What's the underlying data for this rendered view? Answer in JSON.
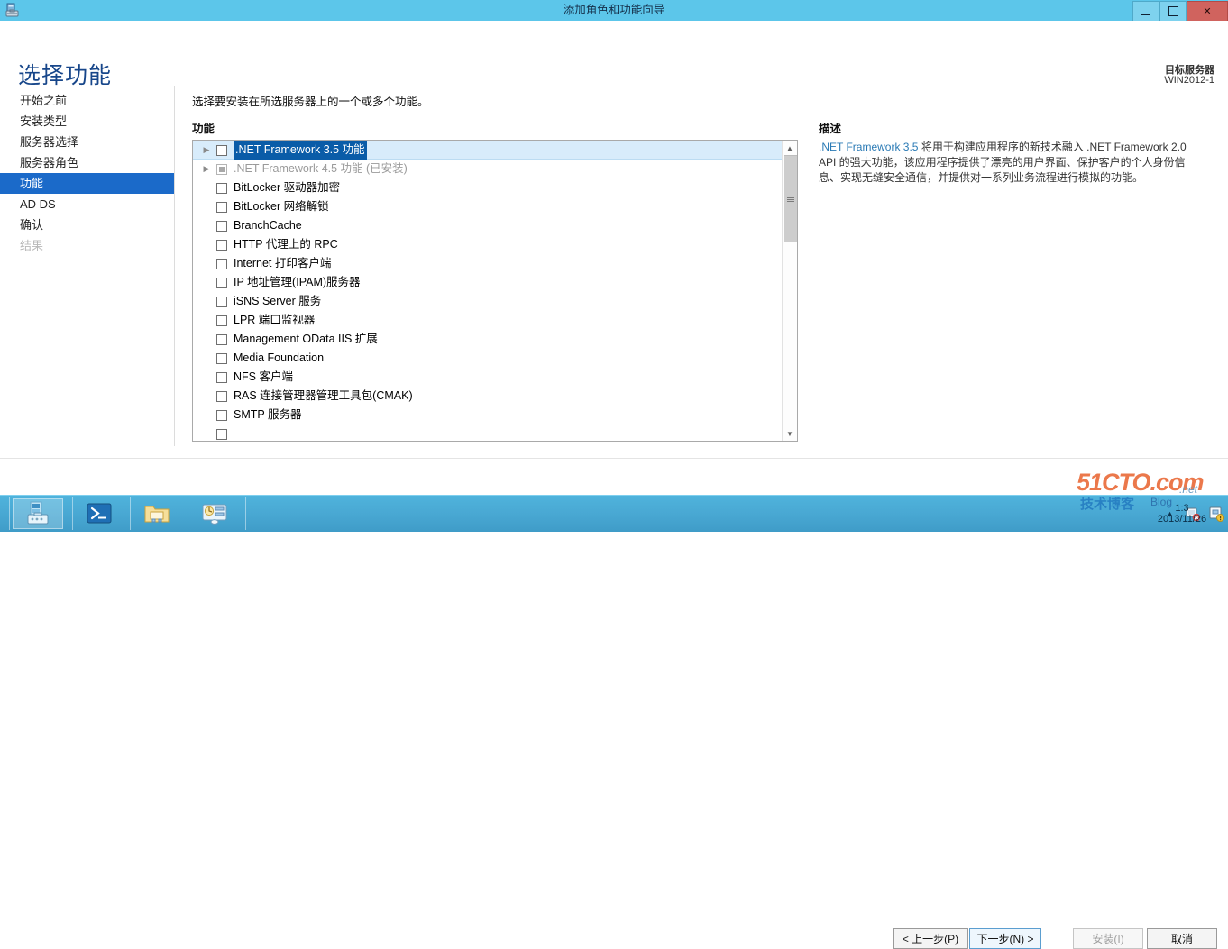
{
  "window": {
    "title": "添加角色和功能向导",
    "icon": "wizard-icon",
    "buttons": {
      "minimize": "minimize-icon",
      "restore": "restore-icon",
      "close": "✕"
    }
  },
  "header": {
    "page_title": "选择功能",
    "target_server_label": "目标服务器",
    "target_server_name": "WIN2012-1"
  },
  "sidebar": {
    "items": [
      {
        "label": "开始之前",
        "state": "normal"
      },
      {
        "label": "安装类型",
        "state": "normal"
      },
      {
        "label": "服务器选择",
        "state": "normal"
      },
      {
        "label": "服务器角色",
        "state": "normal"
      },
      {
        "label": "功能",
        "state": "active"
      },
      {
        "label": "AD DS",
        "state": "normal"
      },
      {
        "label": "确认",
        "state": "normal"
      },
      {
        "label": "结果",
        "state": "disabled"
      }
    ]
  },
  "main": {
    "instruction": "选择要安装在所选服务器上的一个或多个功能。",
    "list_label": "功能",
    "features": [
      {
        "label": ".NET Framework 3.5 功能",
        "checkbox": "unchecked",
        "expandable": true,
        "selected": true,
        "installed": false
      },
      {
        "label": ".NET Framework 4.5 功能 (已安装)",
        "checkbox": "filled",
        "expandable": true,
        "selected": false,
        "installed": true
      },
      {
        "label": "BitLocker 驱动器加密",
        "checkbox": "unchecked",
        "expandable": false,
        "selected": false,
        "installed": false
      },
      {
        "label": "BitLocker 网络解锁",
        "checkbox": "unchecked",
        "expandable": false,
        "selected": false,
        "installed": false
      },
      {
        "label": "BranchCache",
        "checkbox": "unchecked",
        "expandable": false,
        "selected": false,
        "installed": false
      },
      {
        "label": "HTTP 代理上的 RPC",
        "checkbox": "unchecked",
        "expandable": false,
        "selected": false,
        "installed": false
      },
      {
        "label": "Internet 打印客户端",
        "checkbox": "unchecked",
        "expandable": false,
        "selected": false,
        "installed": false
      },
      {
        "label": "IP 地址管理(IPAM)服务器",
        "checkbox": "unchecked",
        "expandable": false,
        "selected": false,
        "installed": false
      },
      {
        "label": "iSNS Server 服务",
        "checkbox": "unchecked",
        "expandable": false,
        "selected": false,
        "installed": false
      },
      {
        "label": "LPR 端口监视器",
        "checkbox": "unchecked",
        "expandable": false,
        "selected": false,
        "installed": false
      },
      {
        "label": "Management OData IIS 扩展",
        "checkbox": "unchecked",
        "expandable": false,
        "selected": false,
        "installed": false
      },
      {
        "label": "Media Foundation",
        "checkbox": "unchecked",
        "expandable": false,
        "selected": false,
        "installed": false
      },
      {
        "label": "NFS 客户端",
        "checkbox": "unchecked",
        "expandable": false,
        "selected": false,
        "installed": false
      },
      {
        "label": "RAS 连接管理器管理工具包(CMAK)",
        "checkbox": "unchecked",
        "expandable": false,
        "selected": false,
        "installed": false
      },
      {
        "label": "SMTP 服务器",
        "checkbox": "unchecked",
        "expandable": false,
        "selected": false,
        "installed": false
      }
    ],
    "scrollbar": {
      "up_arrow": "▲",
      "down_arrow": "▼"
    }
  },
  "description": {
    "title": "描述",
    "highlight": ".NET Framework 3.5",
    "text": " 将用于构建应用程序的新技术融入 .NET Framework 2.0 API 的强大功能，该应用程序提供了漂亮的用户界面、保护客户的个人身份信息、实现无缝安全通信，并提供对一系列业务流程进行模拟的功能。"
  },
  "footer": {
    "previous": "< 上一步(P)",
    "next": "下一步(N) >",
    "install": "安装(I)",
    "cancel": "取消"
  },
  "taskbar": {
    "start_icon": "server-manager-icon",
    "items": [
      {
        "icon": "powershell-icon"
      },
      {
        "icon": "file-explorer-icon"
      },
      {
        "icon": "control-panel-icon"
      }
    ],
    "tray": {
      "chevron": "▲",
      "icons": [
        "network-warning-icon",
        "flag-notification-icon"
      ],
      "time": "1:3",
      "date": "2013/11/26"
    }
  },
  "watermark": {
    "main": "51CTO",
    "dotcom": ".com",
    "net": ".net",
    "blog": "Blog",
    "sub": "技术博客"
  },
  "colors": {
    "titlebar": "#5cc6ea",
    "accent": "#1b6ac9",
    "page_title": "#17468a",
    "selection": "#0a5ca8",
    "row_highlight": "#d8ecfb",
    "close_button": "#d0635e",
    "taskbar": "#49a8d3",
    "watermark": "#e8612c"
  }
}
